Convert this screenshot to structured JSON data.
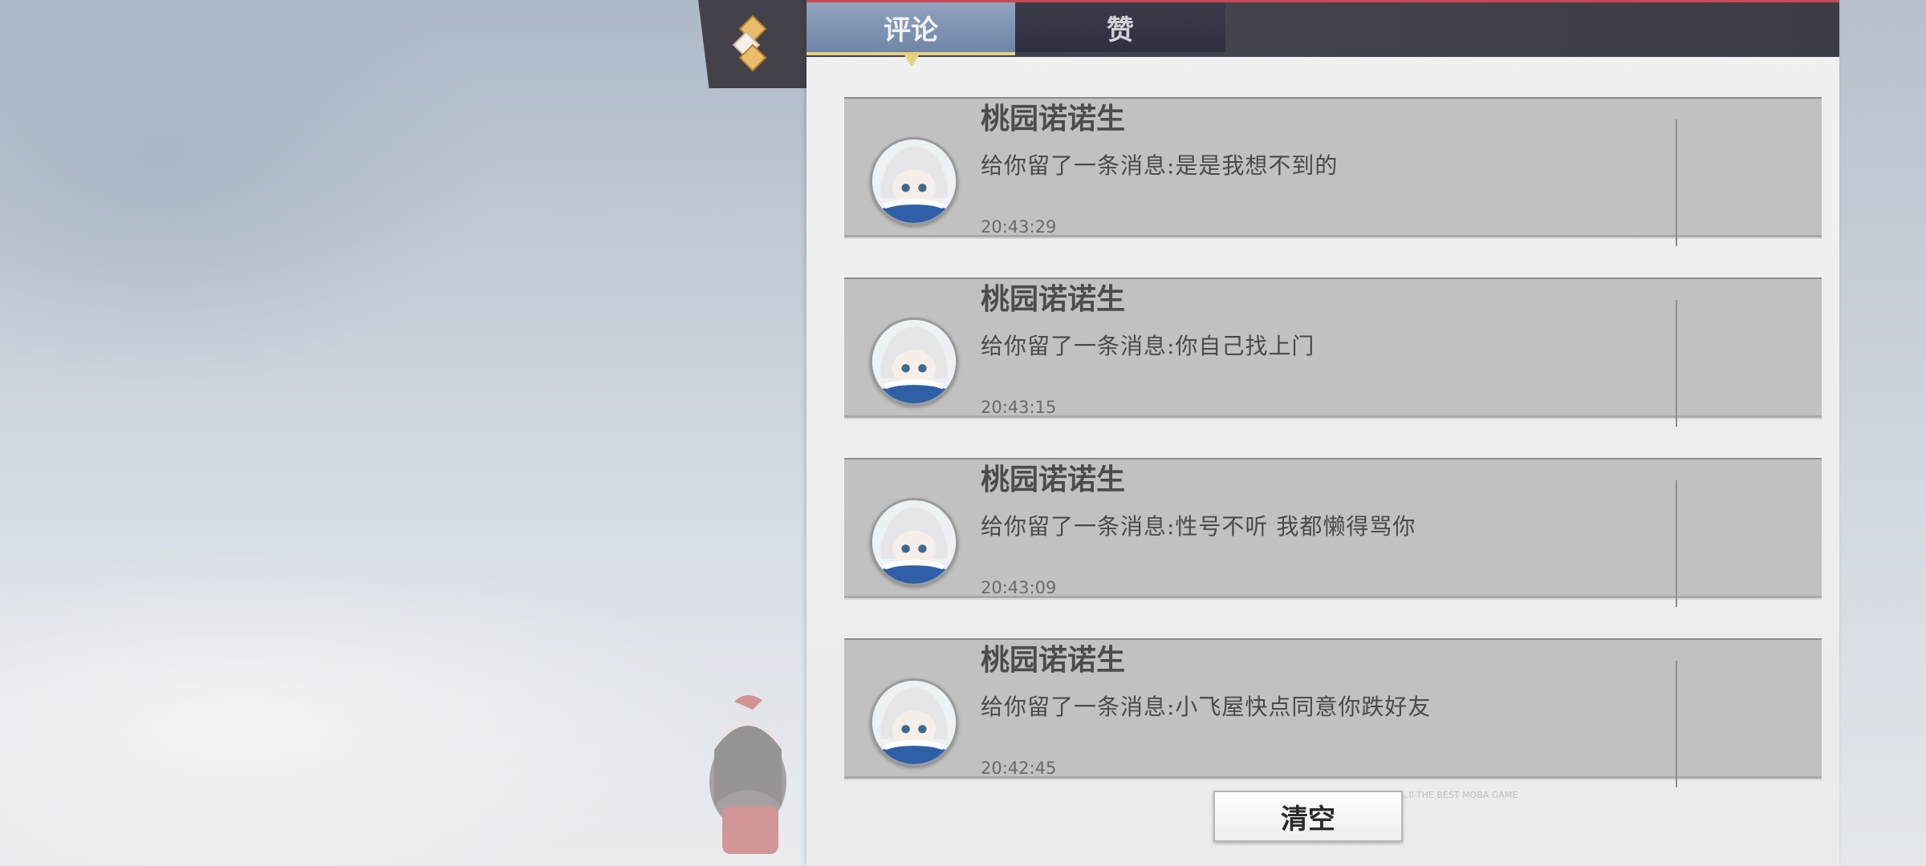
{
  "tabs": {
    "comments_label": "评论",
    "likes_label": "赞"
  },
  "comments": [
    {
      "name": "桃园诺诺生",
      "message": "给你留了一条消息:是是我想不到的",
      "time": "20:43:29"
    },
    {
      "name": "桃园诺诺生",
      "message": "给你留了一条消息:你自己找上门",
      "time": "20:43:15"
    },
    {
      "name": "桃园诺诺生",
      "message": "给你留了一条消息:性号不听 我都懒得骂你",
      "time": "20:43:09"
    },
    {
      "name": "桃园诺诺生",
      "message": "给你留了一条消息:小飞屋快点同意你跌好友",
      "time": "20:42:45"
    }
  ],
  "buttons": {
    "clear_label": "清空"
  },
  "watermark": "...II-THE BEST MOBA GAME",
  "colors": {
    "active_tab": "#7d93b4",
    "accent": "#e6d27a",
    "card_bg": "#c1c1c1"
  },
  "icons": {
    "menu": "diamond-menu-icon",
    "avatar": "anime-avatar-icon"
  }
}
